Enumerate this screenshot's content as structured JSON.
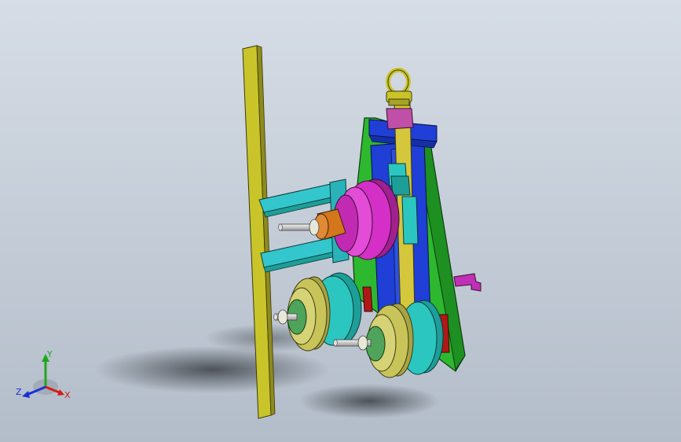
{
  "viewport": {
    "background_top": "#d6dde6",
    "background_bottom": "#b3bdc9"
  },
  "colors": {
    "frame_green": "#2db82f",
    "slide_blue": "#1f3fd6",
    "rail_yellow": "#c9c42a",
    "bracket_cyan": "#33c6cc",
    "roller_magenta": "#d42fc6",
    "hub_orange": "#d4761c",
    "roller_olive": "#c8c45a",
    "roller_teal": "#2cc6c0",
    "pad_red": "#b01818",
    "screw_yellow": "#d4c73c",
    "handle_magenta": "#c02fb5",
    "block_pink": "#c04fa8"
  },
  "triad": {
    "x_label": "X",
    "y_label": "Y",
    "z_label": "Z",
    "x_color": "#d61a1a",
    "y_color": "#1fa51f",
    "z_color": "#1a2fd6"
  }
}
